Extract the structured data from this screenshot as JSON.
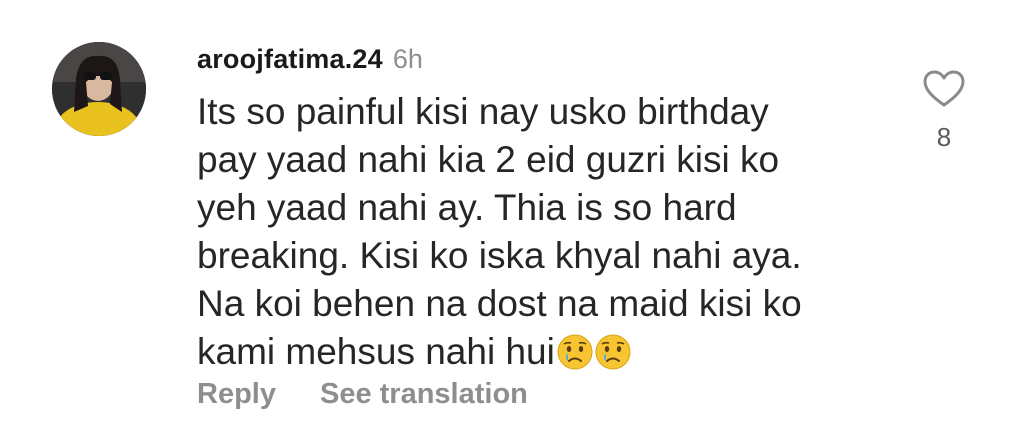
{
  "comment": {
    "username": "aroojfatima.24",
    "time": "6h",
    "lines": [
      "Its so painful kisi nay usko birthday",
      "pay yaad nahi kia 2 eid guzri kisi ko",
      "yeh yaad nahi ay. Thia is so hard",
      "breaking. Kisi ko iska khyal nahi aya.",
      "Na koi behen na dost na maid kisi ko",
      "kami mehsus nahi hui"
    ],
    "emojis": [
      "crying-face",
      "crying-face"
    ],
    "actions": {
      "reply": "Reply",
      "see_translation": "See translation"
    },
    "like": {
      "icon": "heart-outline-icon",
      "count": "8"
    }
  }
}
